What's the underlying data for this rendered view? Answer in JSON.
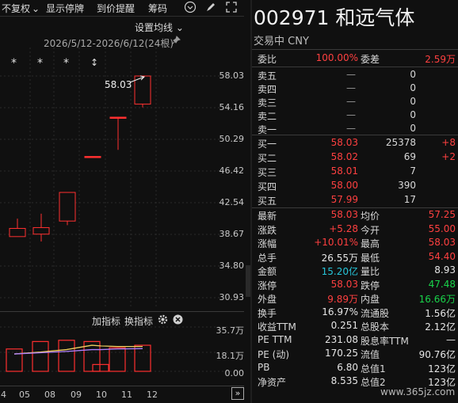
{
  "toolbar": {
    "adj": "不复权",
    "adj_caret": "⌄",
    "show_stop": "显示停牌",
    "alert": "到价提醒",
    "chips": "筹码"
  },
  "chart": {
    "ma_setting": "设置均线",
    "ma_caret": "⌄",
    "range": "2026/5/12-2026/6/12(24根)",
    "last_price_label": "58.03",
    "markers": [
      "*",
      "*",
      "*",
      "↕"
    ],
    "y_labels": [
      "58.03",
      "54.16",
      "50.29",
      "46.42",
      "42.54",
      "38.67",
      "34.80",
      "30.93"
    ],
    "volume_labels": [
      "35.7万",
      "18.1万",
      "0.00"
    ],
    "x_labels": [
      "4",
      "05",
      "08",
      "09",
      "10",
      "11",
      "12"
    ],
    "indicator_add": "加指标",
    "indicator_switch": "换指标",
    "expand": "»",
    "collapse": "‹"
  },
  "chart_data": {
    "type": "candlestick",
    "y_range": [
      30.93,
      58.03
    ],
    "candles": [
      {
        "x": "04",
        "open": 38.4,
        "close": 39.4,
        "high": 40.6,
        "low": 38.4
      },
      {
        "x": "05",
        "open": 38.7,
        "close": 39.5,
        "high": 41.2,
        "low": 37.8
      },
      {
        "x": "08",
        "open": 40.3,
        "close": 43.8,
        "high": 43.8,
        "low": 39.8
      },
      {
        "x": "09",
        "open": 48.2,
        "close": 48.2,
        "high": 48.2,
        "low": 48.2
      },
      {
        "x": "10",
        "open": 53.0,
        "close": 53.0,
        "high": 53.0,
        "low": 49.0
      },
      {
        "x": "12",
        "open": 54.6,
        "close": 58.03,
        "high": 58.03,
        "low": 54.2
      }
    ],
    "volume_range": [
      0,
      35.7
    ],
    "volume_bars": [
      {
        "x": "04",
        "value": 18.0
      },
      {
        "x": "05",
        "value": 24.0
      },
      {
        "x": "08",
        "value": 25.0
      },
      {
        "x": "09",
        "value": 24.0
      },
      {
        "x": "10",
        "value": 5.5
      },
      {
        "x": "11",
        "value": 19.0
      },
      {
        "x": "12",
        "value": 21.0
      }
    ],
    "ma_lines": [
      {
        "color": "#f0d060",
        "values": [
          14.0,
          15.5,
          17.5,
          21.0,
          20.5,
          20.0,
          20.0
        ]
      },
      {
        "color": "#b080ff",
        "values": [
          14.0,
          15.0,
          16.0,
          17.5,
          17.5,
          18.0,
          18.3
        ]
      }
    ]
  },
  "stock": {
    "code": "002971",
    "name": "和远气体",
    "status": "交易中",
    "currency": "CNY"
  },
  "weibi": {
    "label": "委比",
    "value": "100.00%",
    "diff_label": "委差",
    "diff_value": "2.59万"
  },
  "asks": [
    {
      "label": "卖五",
      "price": "—",
      "volume": "0"
    },
    {
      "label": "卖四",
      "price": "—",
      "volume": "0"
    },
    {
      "label": "卖三",
      "price": "—",
      "volume": "0"
    },
    {
      "label": "卖二",
      "price": "—",
      "volume": "0"
    },
    {
      "label": "卖一",
      "price": "—",
      "volume": "0"
    }
  ],
  "bids": [
    {
      "label": "买一",
      "price": "58.03",
      "volume": "25378",
      "change": "+8"
    },
    {
      "label": "买二",
      "price": "58.02",
      "volume": "69",
      "change": "+2"
    },
    {
      "label": "买三",
      "price": "58.01",
      "volume": "7",
      "change": ""
    },
    {
      "label": "买四",
      "price": "58.00",
      "volume": "390",
      "change": ""
    },
    {
      "label": "买五",
      "price": "57.99",
      "volume": "17",
      "change": ""
    }
  ],
  "stats": [
    {
      "l1": "最新",
      "v1": "58.03",
      "c1": "red",
      "l2": "均价",
      "v2": "57.25",
      "c2": "red"
    },
    {
      "l1": "涨跌",
      "v1": "+5.28",
      "c1": "red",
      "l2": "今开",
      "v2": "55.00",
      "c2": "red"
    },
    {
      "l1": "涨幅",
      "v1": "+10.01%",
      "c1": "red",
      "l2": "最高",
      "v2": "58.03",
      "c2": "red"
    },
    {
      "l1": "总手",
      "v1": "26.55万",
      "c1": "white",
      "l2": "最低",
      "v2": "54.40",
      "c2": "red"
    },
    {
      "l1": "金额",
      "v1": "15.20亿",
      "c1": "cyan",
      "l2": "量比",
      "v2": "8.93",
      "c2": "white"
    },
    {
      "l1": "涨停",
      "v1": "58.03",
      "c1": "red",
      "l2": "跌停",
      "v2": "47.48",
      "c2": "green"
    },
    {
      "l1": "外盘",
      "v1": "9.89万",
      "c1": "red",
      "l2": "内盘",
      "v2": "16.66万",
      "c2": "green"
    },
    {
      "l1": "换手",
      "v1": "16.97%",
      "c1": "white",
      "l2": "流通股",
      "v2": "1.56亿",
      "c2": "white"
    },
    {
      "l1": "收益TTM",
      "v1": "0.251",
      "c1": "white",
      "l2": "总股本",
      "v2": "2.12亿",
      "c2": "white"
    },
    {
      "l1": "PE TTM",
      "v1": "231.08",
      "c1": "white",
      "l2": "股息率TTM",
      "v2": "—",
      "c2": "white"
    },
    {
      "l1": "PE (动)",
      "v1": "170.25",
      "c1": "white",
      "l2": "流值",
      "v2": "90.76亿",
      "c2": "white"
    },
    {
      "l1": "PB",
      "v1": "6.80",
      "c1": "white",
      "l2": "总值1",
      "v2": "123亿",
      "c2": "white"
    },
    {
      "l1": "净资产",
      "v1": "8.535",
      "c1": "white",
      "l2": "总值2",
      "v2": "123亿",
      "c2": "white"
    }
  ],
  "watermark": "www.365jz.com"
}
